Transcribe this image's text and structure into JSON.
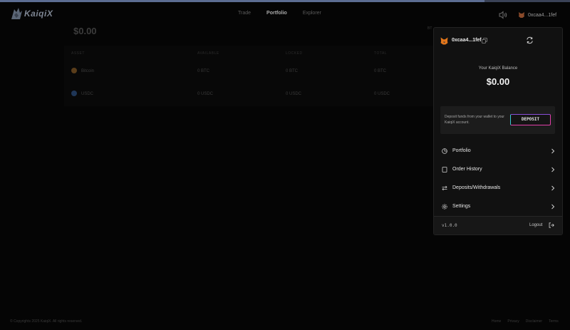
{
  "brand": {
    "name": "KaiqiX"
  },
  "nav": {
    "trade": "Trade",
    "portfolio": "Portfolio",
    "explorer": "Explorer"
  },
  "header": {
    "account": "0xcaa4...1fef"
  },
  "background": {
    "total": "$0.00",
    "clipped": "BT",
    "columns": [
      "ASSET",
      "AVAILABLE",
      "LOCKED",
      "TOTAL"
    ],
    "rows": [
      {
        "asset": "Bitcoin",
        "available": "0 BTC",
        "locked": "0 BTC",
        "total": "0 BTC",
        "coin_color": "#5a3d1a"
      },
      {
        "asset": "USDC",
        "available": "0 USDC",
        "locked": "0 USDC",
        "total": "0 USDC",
        "coin_color": "#1f3657"
      }
    ]
  },
  "dropdown": {
    "address": "0xcaa4...1fef",
    "balance_label": "Your KaiqiX Balance",
    "balance_value": "$0.00",
    "deposit_text": "Deposit funds from your wallet to your KaiqiX account.",
    "deposit_button": "DEPOSIT",
    "menu": [
      {
        "label": "Portfolio",
        "icon": "pie-chart-icon"
      },
      {
        "label": "Order History",
        "icon": "document-icon"
      },
      {
        "label": "Deposits/Withdrawals",
        "icon": "transfer-arrows-icon"
      },
      {
        "label": "Settings",
        "icon": "gear-icon"
      }
    ],
    "version": "v1.0.0",
    "logout": "Logout"
  },
  "footer": {
    "copyright": "© Copyrights 2025 KaiqiX. All rights reserved.",
    "links": [
      "Home",
      "Privacy",
      "Disclaimer",
      "Terms"
    ]
  },
  "colors": {
    "accent_pink": "#e03ea8",
    "accent_cyan": "#37c8d4",
    "background": "#050505",
    "panel": "#111111"
  }
}
